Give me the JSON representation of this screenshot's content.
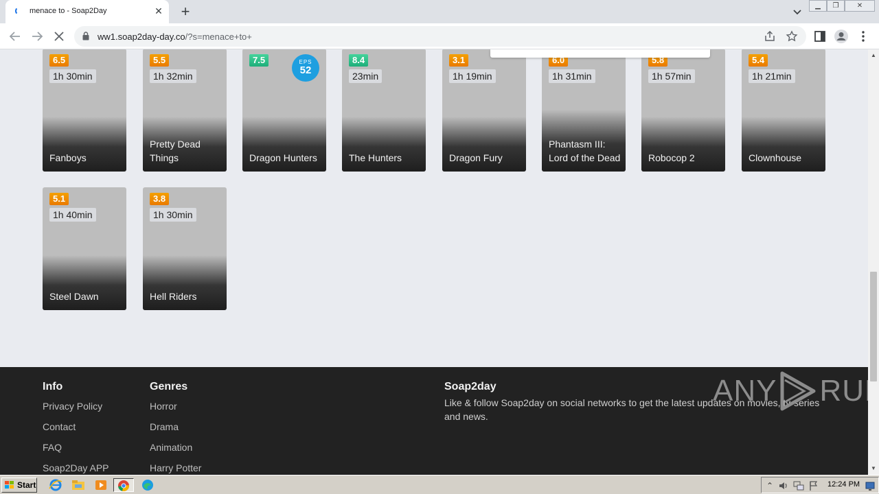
{
  "browser": {
    "tab": {
      "title": "menace to - Soap2Day",
      "close_glyph": "✕"
    },
    "new_tab_glyph": "+",
    "url": {
      "host": "ww1.soap2day-day.co",
      "path": "/?s=menace+to+"
    },
    "icons": [
      "back-arrow-icon",
      "forward-arrow-icon",
      "stop-loading-icon",
      "lock-icon",
      "share-icon",
      "star-icon",
      "side-panel-icon",
      "profile-icon",
      "menu-dots-icon"
    ]
  },
  "movies": [
    {
      "title": "Fanboys",
      "rating": "6.5",
      "duration": "1h 30min",
      "rating_color": "orange"
    },
    {
      "title": "Pretty Dead Things",
      "rating": "5.5",
      "duration": "1h 32min",
      "rating_color": "orange"
    },
    {
      "title": "Dragon Hunters",
      "rating": "7.5",
      "duration": "",
      "rating_color": "green",
      "eps_label": "EPS",
      "eps_count": "52"
    },
    {
      "title": "The Hunters",
      "rating": "8.4",
      "duration": "23min",
      "rating_color": "green"
    },
    {
      "title": "Dragon Fury",
      "rating": "3.1",
      "duration": "1h 19min",
      "rating_color": "orange"
    },
    {
      "title": "Phantasm III: Lord of the Dead",
      "rating": "6.0",
      "duration": "1h 31min",
      "rating_color": "orange"
    },
    {
      "title": "Robocop 2",
      "rating": "5.8",
      "duration": "1h 57min",
      "rating_color": "orange"
    },
    {
      "title": "Clownhouse",
      "rating": "5.4",
      "duration": "1h 21min",
      "rating_color": "orange"
    },
    {
      "title": "Steel Dawn",
      "rating": "5.1",
      "duration": "1h 40min",
      "rating_color": "orange"
    },
    {
      "title": "Hell Riders",
      "rating": "3.8",
      "duration": "1h 30min",
      "rating_color": "orange"
    }
  ],
  "footer": {
    "info": {
      "heading": "Info",
      "links": [
        "Privacy Policy",
        "Contact",
        "FAQ",
        "Soap2Day APP"
      ]
    },
    "genres": {
      "heading": "Genres",
      "links": [
        "Horror",
        "Drama",
        "Animation",
        "Harry Potter"
      ]
    },
    "brand": {
      "heading": "Soap2day",
      "text": "Like & follow Soap2day on social networks to get the latest updates on movies, tv-series and news."
    }
  },
  "watermark": {
    "left": "ANY",
    "right": "RUN"
  },
  "taskbar": {
    "start_label": "Start",
    "clock": "12:24 PM",
    "apps": [
      "internet-explorer-icon",
      "file-explorer-icon",
      "media-player-icon",
      "chrome-icon",
      "edge-icon"
    ]
  }
}
